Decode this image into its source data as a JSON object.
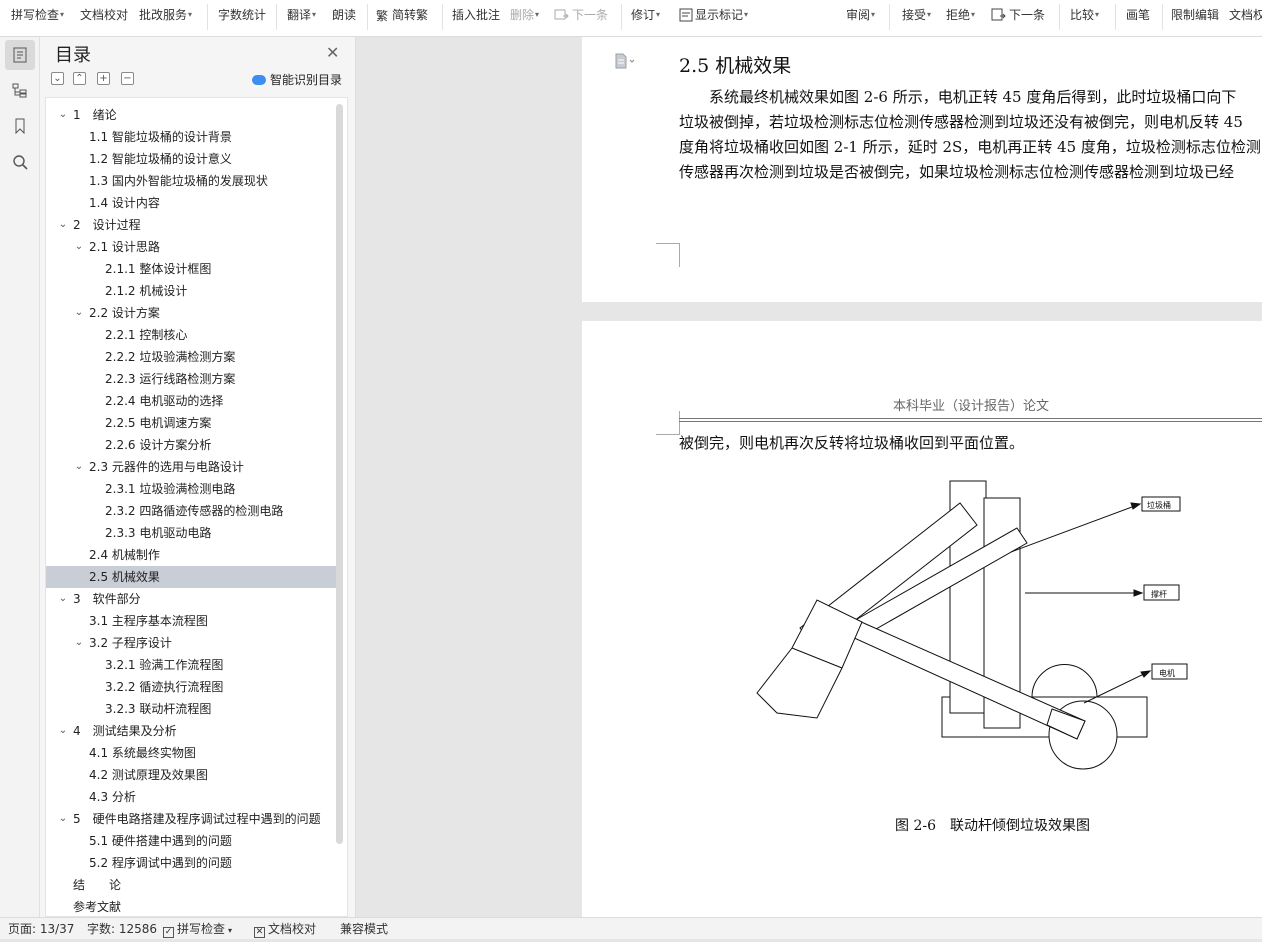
{
  "toolbar": {
    "spell_check": "拼写检查",
    "doc_check": "文档校对",
    "batch_service": "批改服务",
    "word_count": "字数统计",
    "translate": "翻译",
    "read_aloud": "朗读",
    "simp_trad": "简转繁",
    "insert_comment": "插入批注",
    "delete": "删除",
    "next_item": "下一条",
    "revise": "修订",
    "show_marks": "显示标记",
    "review": "审阅",
    "accept": "接受",
    "reject": "拒绝",
    "next_item_2": "下一条",
    "compare": "比较",
    "pen": "画笔",
    "restrict_edit": "限制编辑",
    "doc_rights": "文档权"
  },
  "nav": {
    "title": "目录",
    "smart_toc": "智能识别目录",
    "items": [
      {
        "level": 1,
        "label": "1　绪论",
        "expanded": true
      },
      {
        "level": 2,
        "label": "1.1 智能垃圾桶的设计背景"
      },
      {
        "level": 2,
        "label": "1.2 智能垃圾桶的设计意义"
      },
      {
        "level": 2,
        "label": "1.3 国内外智能垃圾桶的发展现状"
      },
      {
        "level": 2,
        "label": "1.4 设计内容"
      },
      {
        "level": 1,
        "label": "2　设计过程",
        "expanded": true
      },
      {
        "level": 2,
        "label": "2.1 设计思路",
        "expanded": true
      },
      {
        "level": 3,
        "label": "2.1.1 整体设计框图"
      },
      {
        "level": 3,
        "label": "2.1.2 机械设计"
      },
      {
        "level": 2,
        "label": "2.2 设计方案",
        "expanded": true
      },
      {
        "level": 3,
        "label": "2.2.1 控制核心"
      },
      {
        "level": 3,
        "label": "2.2.2 垃圾验满检测方案"
      },
      {
        "level": 3,
        "label": "2.2.3 运行线路检测方案"
      },
      {
        "level": 3,
        "label": "2.2.4 电机驱动的选择"
      },
      {
        "level": 3,
        "label": "2.2.5 电机调速方案"
      },
      {
        "level": 3,
        "label": "2.2.6 设计方案分析"
      },
      {
        "level": 2,
        "label": "2.3 元器件的选用与电路设计",
        "expanded": true
      },
      {
        "level": 3,
        "label": "2.3.1 垃圾验满检测电路"
      },
      {
        "level": 3,
        "label": "2.3.2 四路循迹传感器的检测电路"
      },
      {
        "level": 3,
        "label": "2.3.3 电机驱动电路"
      },
      {
        "level": 2,
        "label": "2.4 机械制作"
      },
      {
        "level": 2,
        "label": "2.5 机械效果",
        "selected": true
      },
      {
        "level": 1,
        "label": "3　软件部分",
        "expanded": true
      },
      {
        "level": 2,
        "label": "3.1 主程序基本流程图"
      },
      {
        "level": 2,
        "label": "3.2 子程序设计",
        "expanded": true
      },
      {
        "level": 3,
        "label": "3.2.1 验满工作流程图"
      },
      {
        "level": 3,
        "label": "3.2.2 循迹执行流程图"
      },
      {
        "level": 3,
        "label": "3.2.3 联动杆流程图"
      },
      {
        "level": 1,
        "label": "4　测试结果及分析",
        "expanded": true
      },
      {
        "level": 2,
        "label": "4.1 系统最终实物图"
      },
      {
        "level": 2,
        "label": "4.2 测试原理及效果图"
      },
      {
        "level": 2,
        "label": "4.3 分析"
      },
      {
        "level": 1,
        "label": "5　硬件电路搭建及程序调试过程中遇到的问题",
        "expanded": true
      },
      {
        "level": 2,
        "label": "5.1 硬件搭建中遇到的问题"
      },
      {
        "level": 2,
        "label": "5.2 程序调试中遇到的问题"
      },
      {
        "level": 0,
        "label": "结　　论"
      },
      {
        "level": 0,
        "label": "参考文献"
      }
    ]
  },
  "document": {
    "section_title": "2.5 机械效果",
    "paragraph_lines": [
      "　　系统最终机械效果如图 2-6 所示，电机正转 45 度角后得到，此时垃圾桶口向下",
      "垃圾被倒掉，若垃圾检测标志位检测传感器检测到垃圾还没有被倒完，则电机反转 45",
      "度角将垃圾桶收回如图 2-1 所示，延时 2S，电机再正转 45 度角，垃圾检测标志位检测",
      "传感器再次检测到垃圾是否被倒完，如果垃圾检测标志位检测传感器检测到垃圾已经"
    ],
    "running_header": "本科毕业（设计报告）论文",
    "continuation_line": "被倒完，则电机再次反转将垃圾桶收回到平面位置。",
    "figure_labels": {
      "bin": "垃圾桶",
      "rod": "撑杆",
      "motor": "电机"
    },
    "figure_caption": "图 2-6　联动杆倾倒垃圾效果图"
  },
  "status": {
    "page": "页面: 13/37",
    "word_count": "字数: 12586",
    "spell_check": "拼写检查",
    "doc_check": "文档校对",
    "compat_mode": "兼容模式"
  }
}
